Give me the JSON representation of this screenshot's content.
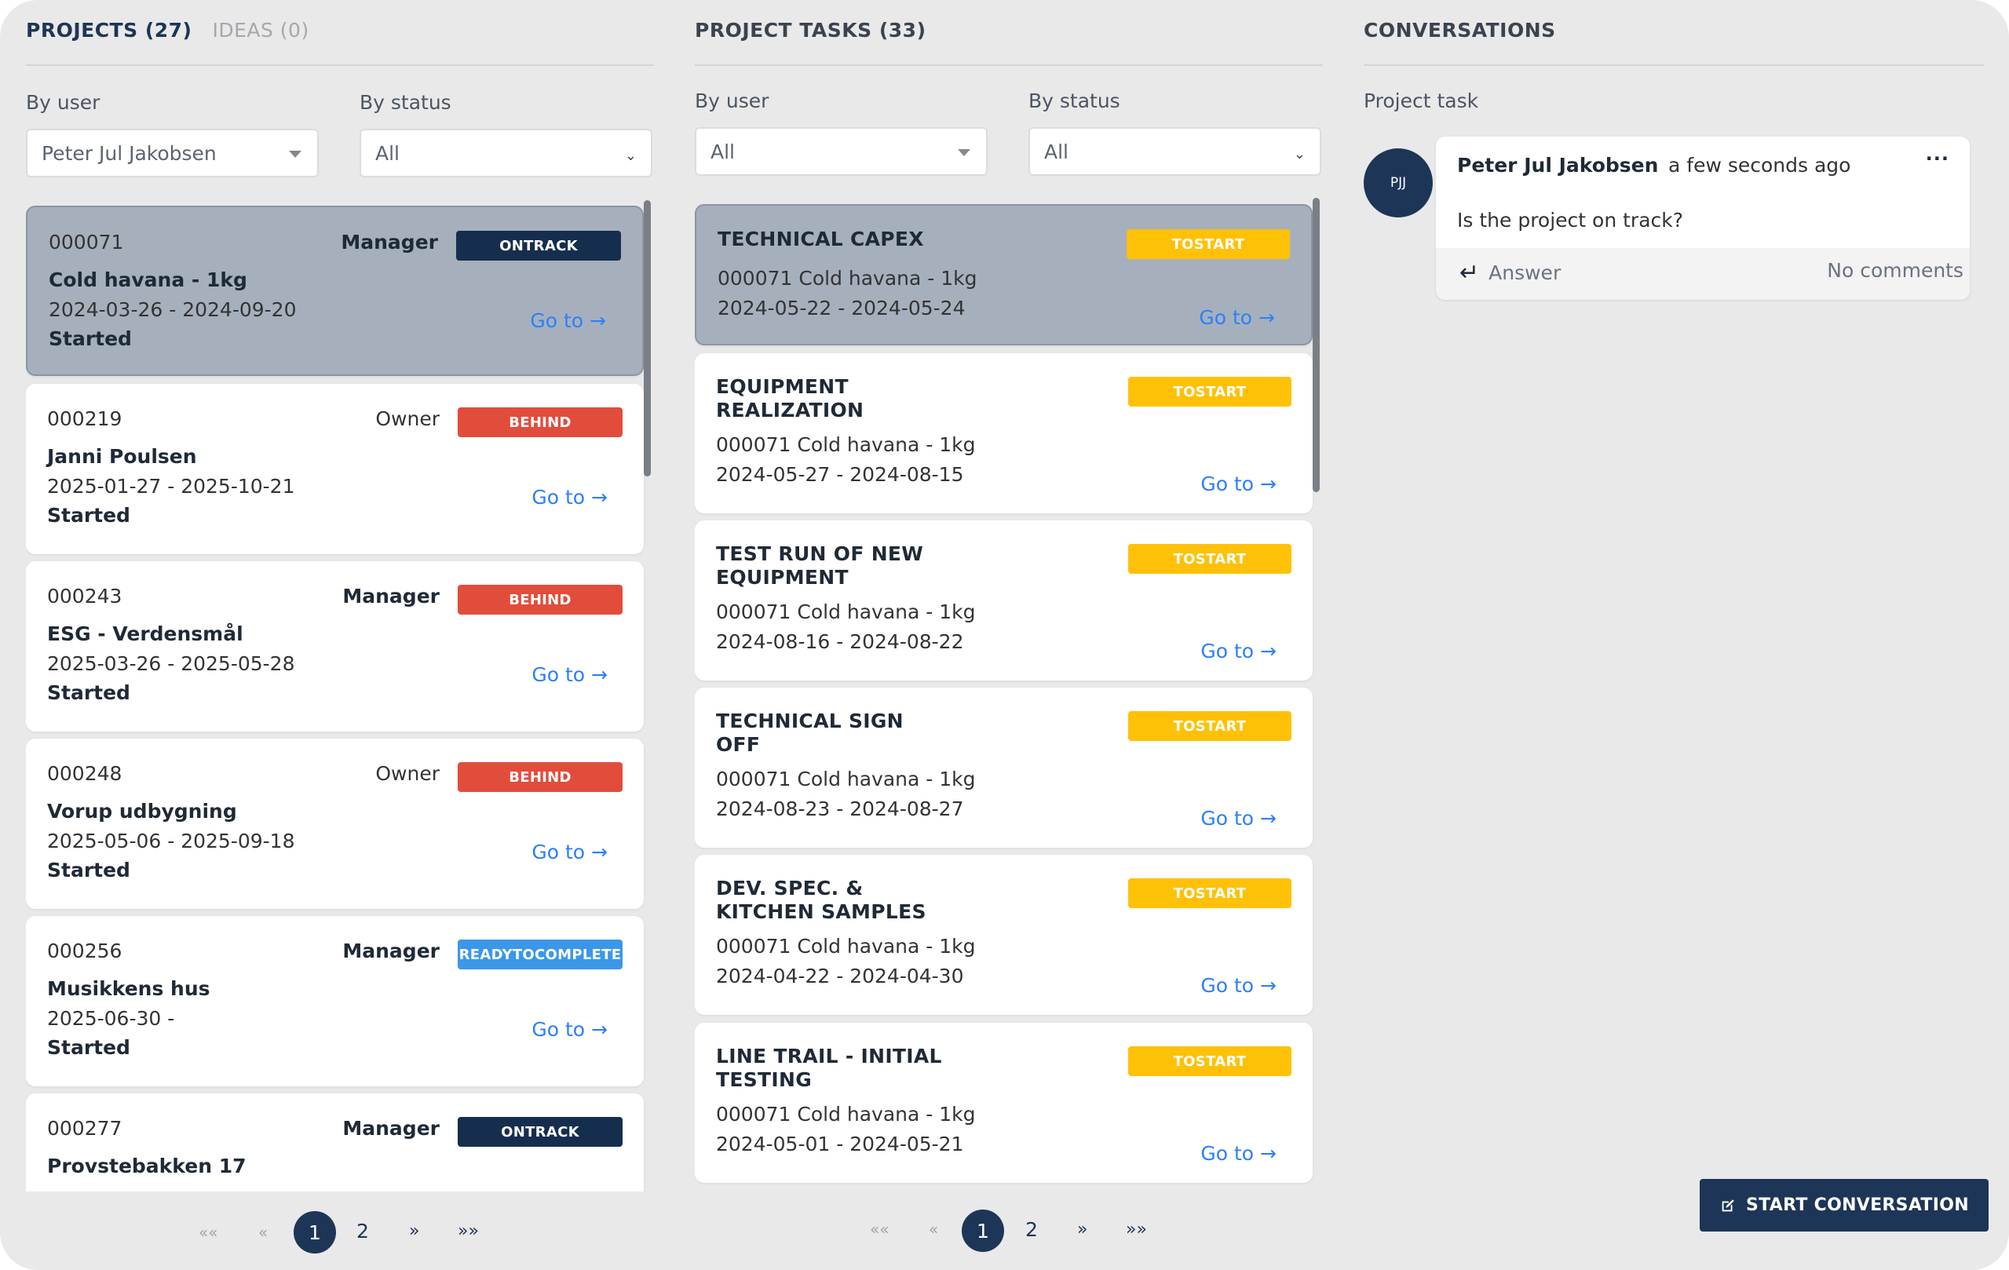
{
  "projects": {
    "tab_projects": "PROJECTS (27)",
    "tab_ideas": "IDEAS (0)",
    "filter_user_label": "By user",
    "filter_user_value": "Peter Jul Jakobsen",
    "filter_status_label": "By status",
    "filter_status_value": "All",
    "goto_label": "Go to →",
    "items": [
      {
        "id": "000071",
        "role": "Manager",
        "badge": "ONTRACK",
        "title": "Cold havana - 1kg",
        "dates": "2024-03-26 - 2024-09-20",
        "status": "Started"
      },
      {
        "id": "000219",
        "role": "Owner",
        "badge": "BEHIND",
        "title": "Janni Poulsen",
        "dates": "2025-01-27 - 2025-10-21",
        "status": "Started"
      },
      {
        "id": "000243",
        "role": "Manager",
        "badge": "BEHIND",
        "title": "ESG - Verdensmål",
        "dates": "2025-03-26 - 2025-05-28",
        "status": "Started"
      },
      {
        "id": "000248",
        "role": "Owner",
        "badge": "BEHIND",
        "title": "Vorup udbygning",
        "dates": "2025-05-06 - 2025-09-18",
        "status": "Started"
      },
      {
        "id": "000256",
        "role": "Manager",
        "badge": "READYTOCOMPLETE",
        "title": "Musikkens hus",
        "dates": "2025-06-30 -",
        "status": "Started"
      },
      {
        "id": "000277",
        "role": "Manager",
        "badge": "ONTRACK",
        "title": "Provstebakken 17",
        "dates": "",
        "status": ""
      }
    ],
    "pager": {
      "first": "««",
      "prev": "«",
      "p1": "1",
      "p2": "2",
      "next": "»",
      "last": "»»"
    }
  },
  "tasks": {
    "header": "PROJECT TASKS (33)",
    "filter_user_label": "By user",
    "filter_user_value": "All",
    "filter_status_label": "By status",
    "filter_status_value": "All",
    "goto_label": "Go to →",
    "items": [
      {
        "title": "TECHNICAL CAPEX",
        "badge": "TOSTART",
        "project": "000071 Cold havana - 1kg",
        "dates": "2024-05-22 - 2024-05-24"
      },
      {
        "title": "EQUIPMENT REALIZATION",
        "badge": "TOSTART",
        "project": "000071 Cold havana - 1kg",
        "dates": "2024-05-27 - 2024-08-15"
      },
      {
        "title": "TEST RUN OF NEW EQUIPMENT",
        "badge": "TOSTART",
        "project": "000071 Cold havana - 1kg",
        "dates": "2024-08-16 - 2024-08-22"
      },
      {
        "title": "TECHNICAL SIGN OFF",
        "badge": "TOSTART",
        "project": "000071 Cold havana - 1kg",
        "dates": "2024-08-23 - 2024-08-27"
      },
      {
        "title": "DEV. SPEC. & KITCHEN SAMPLES",
        "badge": "TOSTART",
        "project": "000071 Cold havana - 1kg",
        "dates": "2024-04-22 - 2024-04-30"
      },
      {
        "title": "LINE TRAIL - INITIAL TESTING",
        "badge": "TOSTART",
        "project": "000071 Cold havana - 1kg",
        "dates": "2024-05-01 - 2024-05-21"
      }
    ],
    "pager": {
      "first": "««",
      "prev": "«",
      "p1": "1",
      "p2": "2",
      "next": "»",
      "last": "»»"
    }
  },
  "conversations": {
    "header": "CONVERSATIONS",
    "subheader": "Project task",
    "message": {
      "avatar": "PJJ",
      "author": "Peter Jul Jakobsen",
      "time": "a few seconds ago",
      "menu": "···",
      "text": "Is the project on track?",
      "answer_label": "Answer",
      "comments": "No comments"
    },
    "start_button": "START CONVERSATION"
  },
  "colors": {
    "navy": "#1d3557",
    "ontrack": "#152e4e",
    "behind": "#e24c3b",
    "readytocomplete": "#3b97e8",
    "tostart": "#ffc107",
    "link": "#2d7ff9"
  }
}
